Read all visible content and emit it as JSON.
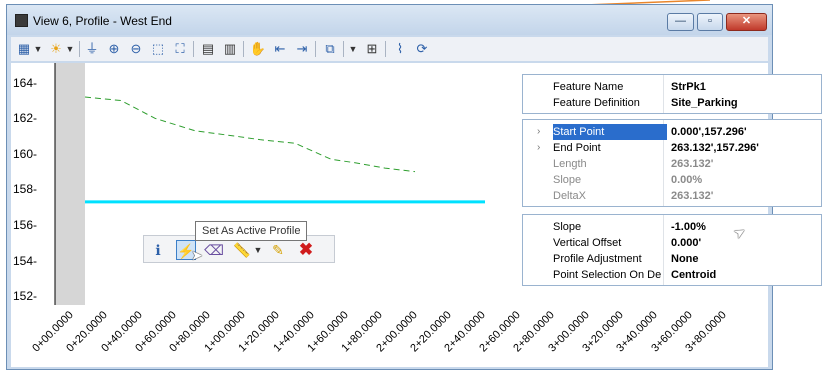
{
  "window": {
    "title": "View 6, Profile - West End"
  },
  "toolbar": {
    "icons": [
      "view-attributes-icon",
      "dropdown-icon",
      "brightness-icon",
      "dropdown-icon",
      "update-icon",
      "zoom-in-icon",
      "zoom-out-icon",
      "window-area-icon",
      "fit-view-icon",
      "rotate-icon",
      "copy-icon",
      "pan-icon",
      "previous-view-icon",
      "next-view-icon",
      "clip-icon",
      "dropdown-icon",
      "grid-icon",
      "profile-icon",
      "refresh-icon"
    ]
  },
  "float_toolbar": {
    "icons": [
      "properties-icon",
      "set-active-profile-icon",
      "eraser-icon",
      "measure-icon",
      "dropdown-icon",
      "pencil-icon",
      "delete-icon"
    ],
    "tooltip": "Set As Active Profile"
  },
  "chart_data": {
    "type": "line",
    "ylim": [
      151.5,
      165
    ],
    "yticks": [
      "164-",
      "162-",
      "160-",
      "158-",
      "156-",
      "154-",
      "152-"
    ],
    "xticks": [
      "0+00.0000",
      "0+20.0000",
      "0+40.0000",
      "0+60.0000",
      "0+80.0000",
      "1+00.0000",
      "1+20.0000",
      "1+40.0000",
      "1+60.0000",
      "1+80.0000",
      "2+00.0000",
      "2+20.0000",
      "2+40.0000",
      "2+60.0000",
      "2+80.0000",
      "3+00.0000",
      "3+20.0000",
      "3+40.0000",
      "3+60.0000",
      "3+80.0000"
    ],
    "series": [
      {
        "style": "dashed",
        "color": "#2e9e2e",
        "x": [
          0,
          36,
          70,
          110,
          150,
          175,
          210,
          246,
          270,
          300,
          330
        ],
        "y": [
          163.2,
          163.0,
          162.0,
          161.3,
          161.0,
          160.8,
          160.6,
          159.7,
          159.5,
          159.2,
          159.0
        ]
      },
      {
        "style": "solid",
        "color": "#00e1ff",
        "x": [
          0,
          400
        ],
        "y": [
          157.3,
          157.3
        ]
      }
    ]
  },
  "panel1": {
    "rows": [
      {
        "name": "Feature Name",
        "value": "StrPk1"
      },
      {
        "name": "Feature Definition",
        "value": "Site_Parking"
      }
    ]
  },
  "panel2": {
    "rows": [
      {
        "name": "Start Point",
        "value": "0.000',157.296'"
      },
      {
        "name": "End Point",
        "value": "263.132',157.296'"
      },
      {
        "name": "Length",
        "value": "263.132'"
      },
      {
        "name": "Slope",
        "value": "0.00%"
      },
      {
        "name": "DeltaX",
        "value": "263.132'"
      }
    ]
  },
  "panel3": {
    "rows": [
      {
        "name": "Slope",
        "value": "-1.00%"
      },
      {
        "name": "Vertical Offset",
        "value": "0.000'"
      },
      {
        "name": "Profile Adjustment",
        "value": "None"
      },
      {
        "name": "Point Selection On De",
        "value": "Centroid"
      }
    ]
  }
}
